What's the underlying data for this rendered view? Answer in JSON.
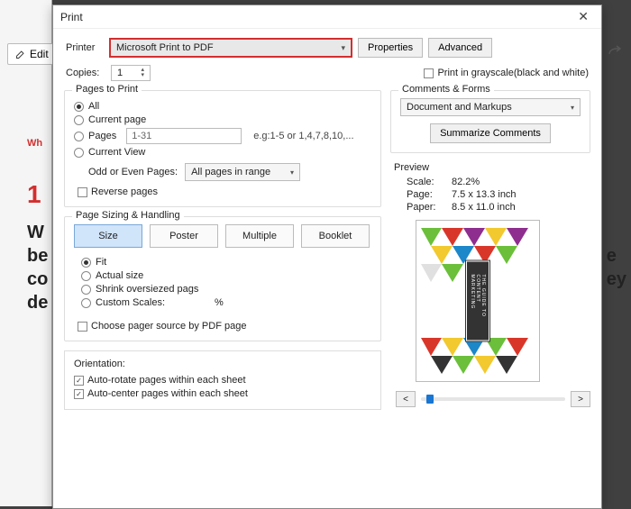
{
  "bg": {
    "edit": "Edit",
    "red_small": "Wh",
    "red_big": "1",
    "black1": "W",
    "black2": "be",
    "black3": "co",
    "black4": "de",
    "right2": "e",
    "right3": "ey"
  },
  "dialog": {
    "title": "Print",
    "printer_label": "Printer",
    "printer_value": "Microsoft Print to PDF",
    "properties": "Properties",
    "advanced": "Advanced",
    "copies_label": "Copies:",
    "copies_value": "1",
    "grayscale": "Print in grayscale(black and white)"
  },
  "pages": {
    "legend": "Pages to Print",
    "all": "All",
    "current_page": "Current page",
    "pages": "Pages",
    "pages_value": "1-31",
    "pages_hint": "e.g:1-5 or 1,4,7,8,10,...",
    "current_view": "Current View",
    "odd_even_label": "Odd or Even Pages:",
    "odd_even_value": "All pages in range",
    "reverse": "Reverse pages"
  },
  "sizing": {
    "legend": "Page Sizing & Handling",
    "size": "Size",
    "poster": "Poster",
    "multiple": "Multiple",
    "booklet": "Booklet",
    "fit": "Fit",
    "actual": "Actual size",
    "shrink": "Shrink oversiezed pags",
    "custom": "Custom Scales:",
    "percent": "%",
    "choose_source": "Choose pager source by PDF page"
  },
  "orient": {
    "legend": "Orientation:",
    "auto_rotate": "Auto-rotate pages within each sheet",
    "auto_center": "Auto-center pages within each sheet"
  },
  "comments": {
    "legend": "Comments & Forms",
    "value": "Document and Markups",
    "summarize": "Summarize Comments"
  },
  "preview": {
    "legend": "Preview",
    "scale_k": "Scale:",
    "scale_v": "82.2%",
    "page_k": "Page:",
    "page_v": "7.5 x 13.3 inch",
    "paper_k": "Paper:",
    "paper_v": "8.5 x 11.0 inch",
    "doc_label": "THE GUIDE TO CONTENT MARKETING",
    "prev": "<",
    "next": ">"
  }
}
